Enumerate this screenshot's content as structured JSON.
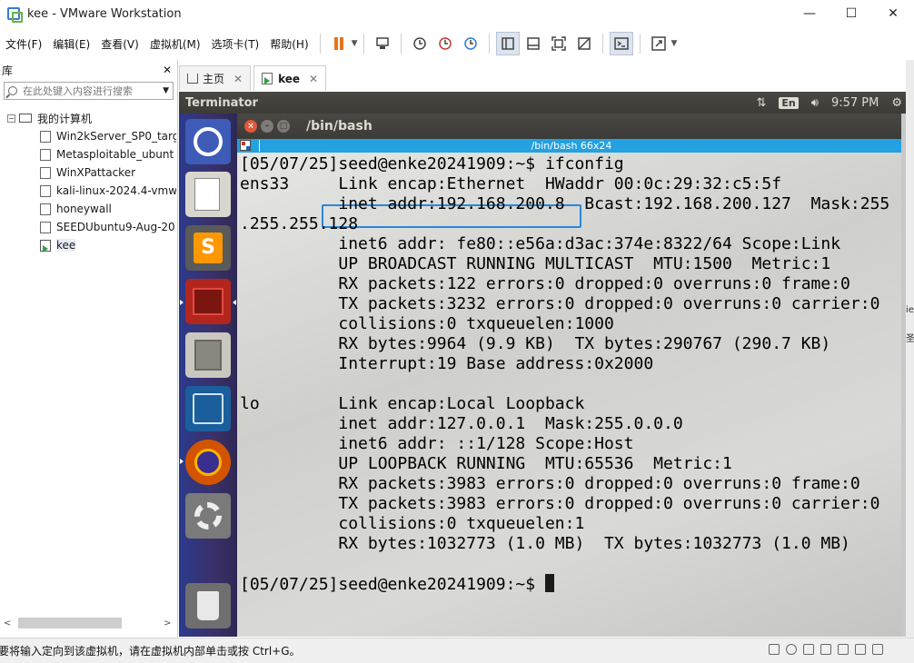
{
  "window": {
    "title": "kee - VMware Workstation",
    "controls": {
      "minimize": "—",
      "maximize": "☐",
      "close": "✕"
    }
  },
  "menu": {
    "file": "文件(F)",
    "edit": "编辑(E)",
    "view": "查看(V)",
    "vm": "虚拟机(M)",
    "tabs": "选项卡(T)",
    "help": "帮助(H)"
  },
  "toolbar": {
    "icons": [
      "pause-icon",
      "send-keys-icon",
      "snapshot-icon",
      "revert-snapshot-icon",
      "snapshot-manager-icon",
      "library-view-icon",
      "console-view-icon",
      "fullscreen-icon",
      "unity-icon",
      "terminal-icon",
      "stretch-icon"
    ]
  },
  "library": {
    "title": "库",
    "close": "✕",
    "search_placeholder": "在此处键入内容进行搜索",
    "root_label": "我的计算机",
    "items": [
      {
        "label": "Win2kServer_SP0_targ",
        "running": false
      },
      {
        "label": "Metasploitable_ubunt",
        "running": false
      },
      {
        "label": "WinXPattacker",
        "running": false
      },
      {
        "label": "kali-linux-2024.4-vmw",
        "running": false
      },
      {
        "label": "honeywall",
        "running": false
      },
      {
        "label": "SEEDUbuntu9-Aug-20",
        "running": false
      },
      {
        "label": "kee",
        "running": true
      }
    ]
  },
  "tabs": [
    {
      "label": "主页",
      "close": "✕"
    },
    {
      "label": "kee",
      "close": "✕"
    }
  ],
  "guest": {
    "panel_app_name": "Terminator",
    "lang": "En",
    "clock": "9:57 PM",
    "terminal_title": "/bin/bash",
    "terminal_bar": "/bin/bash 66x24",
    "output": "[05/07/25]seed@enke20241909:~$ ifconfig\nens33     Link encap:Ethernet  HWaddr 00:0c:29:32:c5:5f  \n          inet addr:192.168.200.8  Bcast:192.168.200.127  Mask:255\n.255.255.128\n          inet6 addr: fe80::e56a:d3ac:374e:8322/64 Scope:Link\n          UP BROADCAST RUNNING MULTICAST  MTU:1500  Metric:1\n          RX packets:122 errors:0 dropped:0 overruns:0 frame:0\n          TX packets:3232 errors:0 dropped:0 overruns:0 carrier:0\n          collisions:0 txqueuelen:1000 \n          RX bytes:9964 (9.9 KB)  TX bytes:290767 (290.7 KB)\n          Interrupt:19 Base address:0x2000 \n\nlo        Link encap:Local Loopback  \n          inet addr:127.0.0.1  Mask:255.0.0.0\n          inet6 addr: ::1/128 Scope:Host\n          UP LOOPBACK RUNNING  MTU:65536  Metric:1\n          RX packets:3983 errors:0 dropped:0 overruns:0 frame:0\n          TX packets:3983 errors:0 dropped:0 overruns:0 carrier:0\n          collisions:0 txqueuelen:1 \n          RX bytes:1032773 (1.0 MB)  TX bytes:1032773 (1.0 MB)\n\n[05/07/25]seed@enke20241909:~$ ",
    "launcher": [
      "ubuntu-icon",
      "text-editor-icon",
      "sublime-icon",
      "red-app-icon",
      "files-icon",
      "wireshark-icon",
      "firefox-icon",
      "settings-icon",
      "trash-icon"
    ]
  },
  "statusbar": {
    "text": "要将输入定向到该虚拟机，请在虚拟机内部单击或按 Ctrl+G。"
  },
  "right_strip": {
    "chars": [
      "ie",
      "圣"
    ]
  }
}
